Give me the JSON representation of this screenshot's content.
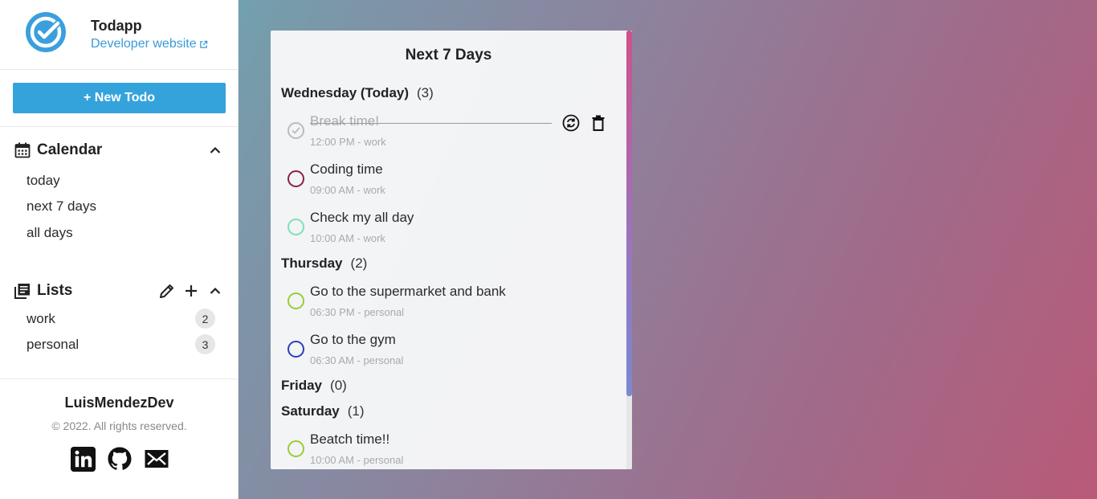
{
  "brand": {
    "app_name": "Todapp",
    "dev_link": "Developer website"
  },
  "sidebar": {
    "new_todo_label": "+ New Todo",
    "calendar": {
      "title": "Calendar",
      "items": [
        {
          "label": "today"
        },
        {
          "label": "next 7 days"
        },
        {
          "label": "all days"
        }
      ]
    },
    "lists": {
      "title": "Lists",
      "items": [
        {
          "name": "work",
          "count": "2"
        },
        {
          "name": "personal",
          "count": "3"
        }
      ]
    },
    "footer": {
      "name": "LuisMendezDev",
      "copyright": "© 2022. All rights reserved."
    }
  },
  "main": {
    "title": "Next 7 Days",
    "days": [
      {
        "name": "Wednesday (Today)",
        "count": "(3)",
        "todos": [
          {
            "title": "Break time!",
            "meta": "12:00 PM - work",
            "done": true,
            "color": "#bbbbbb"
          },
          {
            "title": "Coding time",
            "meta": "09:00 AM - work",
            "done": false,
            "color": "#8a1f4a"
          },
          {
            "title": "Check my all day",
            "meta": "10:00 AM - work",
            "done": false,
            "color": "#7fe0b8"
          }
        ]
      },
      {
        "name": "Thursday",
        "count": "(2)",
        "todos": [
          {
            "title": "Go to the supermarket and bank",
            "meta": "06:30 PM - personal",
            "done": false,
            "color": "#9acd32"
          },
          {
            "title": "Go to the gym",
            "meta": "06:30 AM - personal",
            "done": false,
            "color": "#2a3fb8"
          }
        ]
      },
      {
        "name": "Friday",
        "count": "(0)",
        "todos": []
      },
      {
        "name": "Saturday",
        "count": "(1)",
        "todos": [
          {
            "title": "Beatch time!!",
            "meta": "10:00 AM - personal",
            "done": false,
            "color": "#9acd32"
          }
        ]
      }
    ]
  },
  "colors": {
    "accent": "#34a3dc",
    "link": "#3a9ad9"
  }
}
